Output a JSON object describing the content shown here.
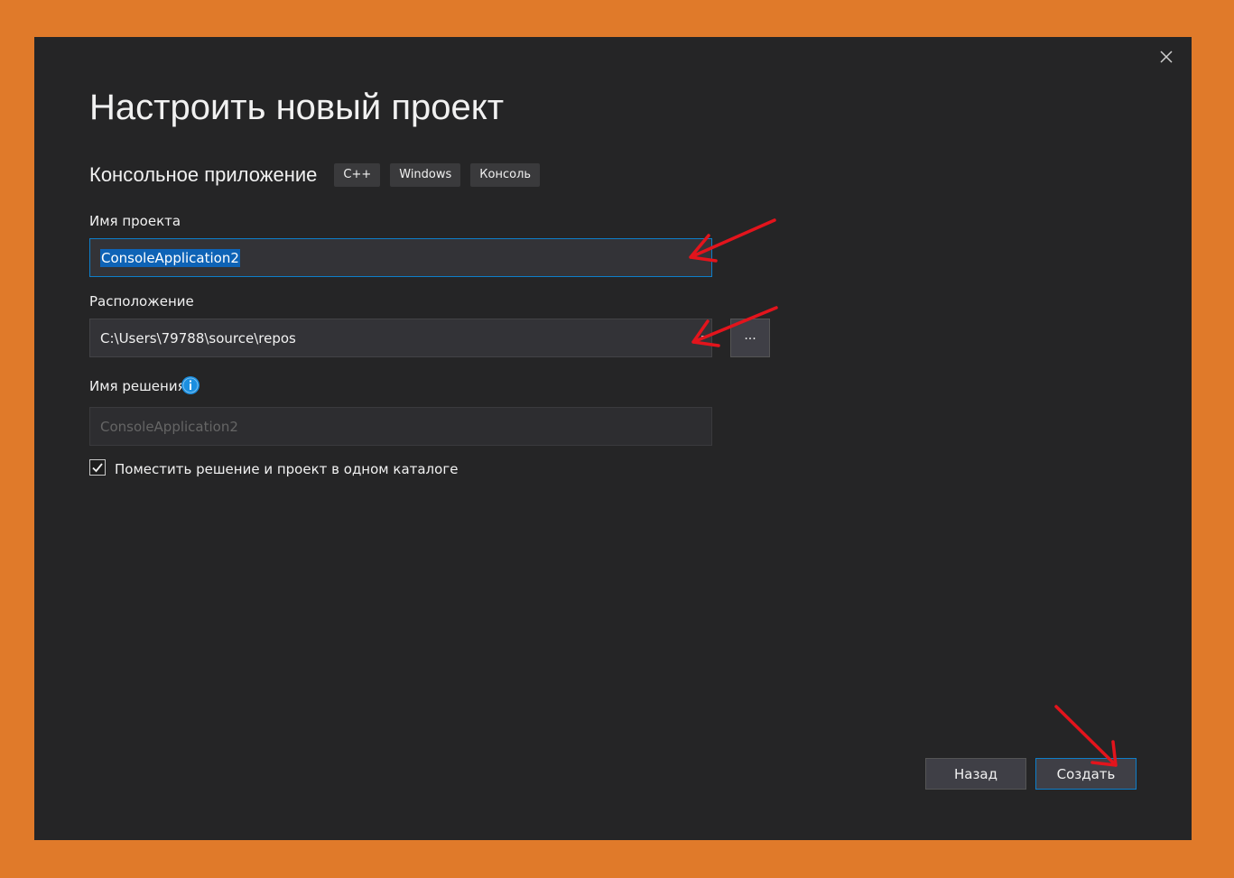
{
  "dialog": {
    "title": "Настроить новый проект",
    "template_name": "Консольное приложение",
    "tags": [
      "C++",
      "Windows",
      "Консоль"
    ],
    "close_icon": "close-icon"
  },
  "project_name": {
    "label": "Имя проекта",
    "value": "ConsoleApplication2"
  },
  "location": {
    "label": "Расположение",
    "value": "C:\\Users\\79788\\source\\repos",
    "browse_label": "..."
  },
  "solution_name": {
    "label": "Имя решения",
    "info_icon": "info-icon",
    "placeholder": "ConsoleApplication2"
  },
  "same_directory": {
    "label": "Поместить решение и проект в одном каталоге",
    "checked": true
  },
  "buttons": {
    "back": "Назад",
    "create": "Создать"
  },
  "colors": {
    "background": "#e07a2a",
    "dialog": "#252526",
    "accent": "#0e7ec9",
    "annotation": "#e3141c"
  }
}
